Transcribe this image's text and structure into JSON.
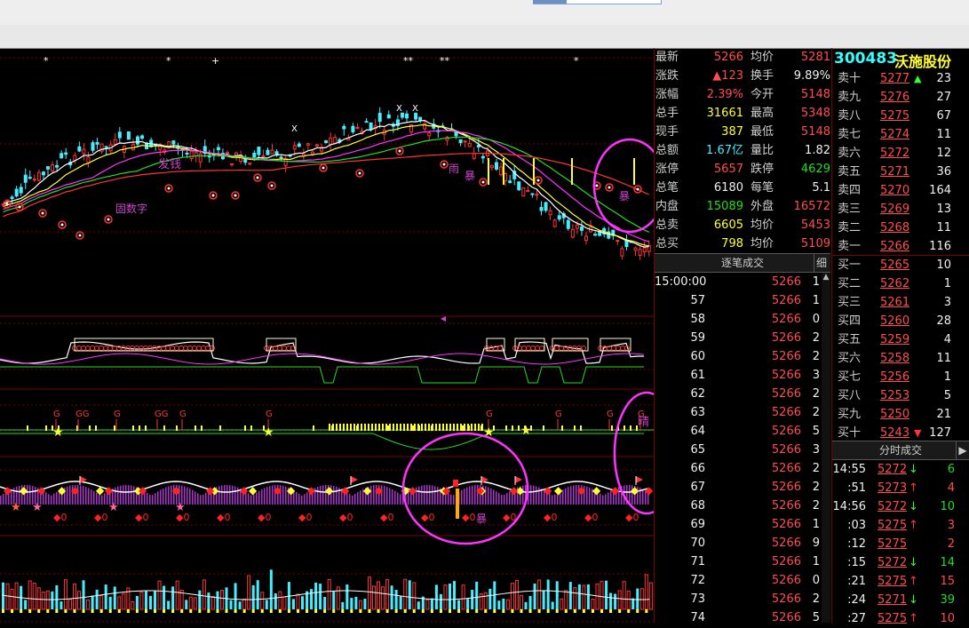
{
  "quote": {
    "code": "300483",
    "name": "沃施股份",
    "rows": [
      {
        "l1": "最新",
        "v1": "5266",
        "c1": "red",
        "l2": "均价",
        "v2": "5281",
        "c2": "red"
      },
      {
        "l1": "涨跌",
        "v1": "▲123",
        "c1": "red",
        "l2": "换手",
        "v2": "9.89%",
        "c2": "white"
      },
      {
        "l1": "涨幅",
        "v1": "2.39%",
        "c1": "red",
        "l2": "今开",
        "v2": "5148",
        "c2": "red"
      },
      {
        "l1": "总手",
        "v1": "31661",
        "c1": "yellow",
        "l2": "最高",
        "v2": "5348",
        "c2": "red"
      },
      {
        "l1": "现手",
        "v1": "387",
        "c1": "yellow",
        "l2": "最低",
        "v2": "5148",
        "c2": "red"
      },
      {
        "l1": "总额",
        "v1": "1.67亿",
        "c1": "cyan",
        "l2": "量比",
        "v2": "1.82",
        "c2": "white"
      },
      {
        "l1": "涨停",
        "v1": "5657",
        "c1": "red",
        "l2": "跌停",
        "v2": "4629",
        "c2": "green"
      },
      {
        "l1": "总笔",
        "v1": "6180",
        "c1": "white",
        "l2": "每笔",
        "v2": "5.1",
        "c2": "white"
      },
      {
        "l1": "内盘",
        "v1": "15089",
        "c1": "green",
        "l2": "外盘",
        "v2": "16572",
        "c2": "red"
      },
      {
        "l1": "总卖",
        "v1": "6605",
        "c1": "yellow",
        "l2": "均价",
        "v2": "5453",
        "c2": "red"
      },
      {
        "l1": "总买",
        "v1": "798",
        "c1": "yellow",
        "l2": "均价",
        "v2": "5109",
        "c2": "red"
      }
    ]
  },
  "orderbook": {
    "sell": [
      {
        "label": "卖十",
        "price": "5277",
        "mark": "▲",
        "vol": "23"
      },
      {
        "label": "卖九",
        "price": "5276",
        "mark": "",
        "vol": "27"
      },
      {
        "label": "卖八",
        "price": "5275",
        "mark": "",
        "vol": "67"
      },
      {
        "label": "卖七",
        "price": "5274",
        "mark": "",
        "vol": "11"
      },
      {
        "label": "卖六",
        "price": "5272",
        "mark": "",
        "vol": "12"
      },
      {
        "label": "卖五",
        "price": "5271",
        "mark": "",
        "vol": "36"
      },
      {
        "label": "卖四",
        "price": "5270",
        "mark": "",
        "vol": "164"
      },
      {
        "label": "卖三",
        "price": "5269",
        "mark": "",
        "vol": "13"
      },
      {
        "label": "卖二",
        "price": "5268",
        "mark": "",
        "vol": "11"
      },
      {
        "label": "卖一",
        "price": "5266",
        "mark": "",
        "vol": "116"
      }
    ],
    "buy": [
      {
        "label": "买一",
        "price": "5265",
        "mark": "",
        "vol": "10"
      },
      {
        "label": "买二",
        "price": "5262",
        "mark": "",
        "vol": "1"
      },
      {
        "label": "买三",
        "price": "5261",
        "mark": "",
        "vol": "3"
      },
      {
        "label": "买四",
        "price": "5260",
        "mark": "",
        "vol": "28"
      },
      {
        "label": "买五",
        "price": "5259",
        "mark": "",
        "vol": "4"
      },
      {
        "label": "买六",
        "price": "5258",
        "mark": "",
        "vol": "11"
      },
      {
        "label": "买七",
        "price": "5256",
        "mark": "",
        "vol": "1"
      },
      {
        "label": "买八",
        "price": "5253",
        "mark": "",
        "vol": "5"
      },
      {
        "label": "买九",
        "price": "5250",
        "mark": "",
        "vol": "21"
      },
      {
        "label": "买十",
        "price": "5243",
        "mark": "▼",
        "vol": "127"
      }
    ]
  },
  "ticks": {
    "tab_label": "逐笔成交",
    "detail_label": "细",
    "rows": [
      {
        "t": "15:00:00",
        "p": "5266",
        "v": "1"
      },
      {
        "t": "57",
        "p": "5266",
        "v": "1"
      },
      {
        "t": "58",
        "p": "5266",
        "v": "0"
      },
      {
        "t": "59",
        "p": "5266",
        "v": "2"
      },
      {
        "t": "60",
        "p": "5266",
        "v": "2"
      },
      {
        "t": "61",
        "p": "5266",
        "v": "3"
      },
      {
        "t": "62",
        "p": "5266",
        "v": "2"
      },
      {
        "t": "63",
        "p": "5266",
        "v": "2"
      },
      {
        "t": "64",
        "p": "5266",
        "v": "5"
      },
      {
        "t": "65",
        "p": "5266",
        "v": "3"
      },
      {
        "t": "66",
        "p": "5266",
        "v": "2"
      },
      {
        "t": "67",
        "p": "5266",
        "v": "2"
      },
      {
        "t": "68",
        "p": "5266",
        "v": "2"
      },
      {
        "t": "69",
        "p": "5266",
        "v": "1"
      },
      {
        "t": "70",
        "p": "5266",
        "v": "9"
      },
      {
        "t": "71",
        "p": "5266",
        "v": "1"
      },
      {
        "t": "72",
        "p": "5266",
        "v": "0"
      },
      {
        "t": "73",
        "p": "5266",
        "v": "2"
      },
      {
        "t": "74",
        "p": "5266",
        "v": "5"
      }
    ]
  },
  "minute": {
    "tab_label": "分时成交",
    "rows": [
      {
        "t": "14:55",
        "p": "5272",
        "d": "dn",
        "v": "6"
      },
      {
        "t": ":51",
        "p": "5273",
        "d": "up",
        "v": "4"
      },
      {
        "t": "14:56",
        "p": "5272",
        "d": "dn",
        "v": "10"
      },
      {
        "t": ":03",
        "p": "5275",
        "d": "up",
        "v": "3"
      },
      {
        "t": ":12",
        "p": "5275",
        "d": "",
        "v": "2"
      },
      {
        "t": ":15",
        "p": "5272",
        "d": "dn",
        "v": "14"
      },
      {
        "t": ":21",
        "p": "5275",
        "d": "up",
        "v": "15"
      },
      {
        "t": ":24",
        "p": "5271",
        "d": "dn",
        "v": "39"
      },
      {
        "t": ":27",
        "p": "5275",
        "d": "up",
        "v": "10"
      }
    ]
  },
  "chart_labels": {
    "fa_qian": "发钱",
    "gu_shu_zi": "固数字",
    "yu": "雨",
    "bao1": "暴",
    "bao2": "暴",
    "jing": "晴",
    "bao3": "暴"
  },
  "colors": {
    "accent_circle": "#ff33ff",
    "grid": "#7a0000",
    "bg": "#000000"
  }
}
